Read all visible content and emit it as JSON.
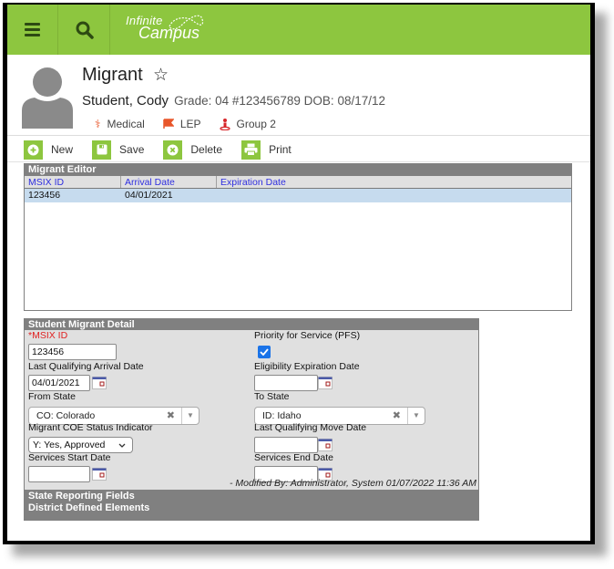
{
  "header": {
    "logo_line1": "Infinite",
    "logo_line2": "Campus",
    "brand_color": "#8dc63f"
  },
  "person": {
    "page_title": "Migrant",
    "name": "Student, Cody",
    "meta": "Grade: 04 #123456789 DOB: 08/17/12",
    "flags": [
      {
        "icon": "medical-icon",
        "label": "Medical"
      },
      {
        "icon": "flag-icon",
        "label": "LEP"
      },
      {
        "icon": "person-icon",
        "label": "Group 2"
      }
    ]
  },
  "toolbar": {
    "new_label": "New",
    "save_label": "Save",
    "delete_label": "Delete",
    "print_label": "Print"
  },
  "editor": {
    "title": "Migrant Editor",
    "columns": [
      "MSIX ID",
      "Arrival Date",
      "Expiration Date"
    ],
    "rows": [
      {
        "msix_id": "123456",
        "arrival_date": "04/01/2021",
        "expiration_date": ""
      }
    ]
  },
  "detail": {
    "title": "Student Migrant Detail",
    "msix_id": {
      "required_mark": "*",
      "label": "MSIX ID",
      "value": "123456"
    },
    "pfs": {
      "label": "Priority for Service (PFS)",
      "checked": true
    },
    "last_arrival": {
      "label": "Last Qualifying Arrival Date",
      "value": "04/01/2021"
    },
    "eligibility_exp": {
      "label": "Eligibility Expiration Date",
      "value": ""
    },
    "from_state": {
      "label": "From State",
      "value": "CO: Colorado"
    },
    "to_state": {
      "label": "To State",
      "value": "ID: Idaho"
    },
    "coe_status": {
      "label": "Migrant COE Status Indicator",
      "value": "Y: Yes, Approved"
    },
    "last_move": {
      "label": "Last Qualifying Move Date",
      "value": ""
    },
    "services_start": {
      "label": "Services Start Date",
      "value": ""
    },
    "services_end": {
      "label": "Services End Date",
      "value": ""
    },
    "modified": "- Modified By: Administrator, System 01/07/2022 11:36 AM",
    "state_reporting": "State Reporting Fields",
    "district_defined": "District Defined Elements"
  }
}
